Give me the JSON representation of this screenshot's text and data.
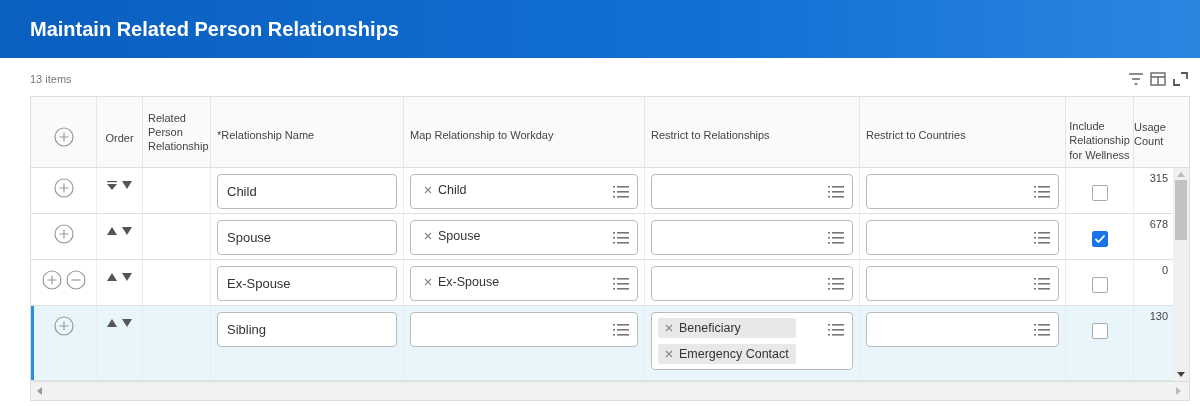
{
  "page": {
    "title": "Maintain Related Person Relationships"
  },
  "grid": {
    "count": "13 items",
    "columns": [
      "Order",
      "Related Person Relationship",
      "*Relationship Name",
      "Map Relationship to Workday",
      "Restrict to Relationships",
      "Restrict to Countries",
      "Include Relationship for Wellness",
      "Usage Count"
    ],
    "rows": [
      {
        "selected": false,
        "removable": false,
        "first": true,
        "name": "Child",
        "map": [
          "Child"
        ],
        "include": false,
        "usage": "315"
      },
      {
        "selected": false,
        "removable": false,
        "first": false,
        "name": "Spouse",
        "map": [
          "Spouse"
        ],
        "include": true,
        "usage": "678"
      },
      {
        "selected": false,
        "removable": true,
        "first": false,
        "name": "Ex-Spouse",
        "map": [
          "Ex-Spouse"
        ],
        "include": false,
        "usage": "0"
      },
      {
        "selected": true,
        "removable": false,
        "first": false,
        "name": "Sibling",
        "restrict": [
          "Beneficiary",
          "Emergency Contact"
        ],
        "include": false,
        "usage": "130"
      }
    ]
  }
}
